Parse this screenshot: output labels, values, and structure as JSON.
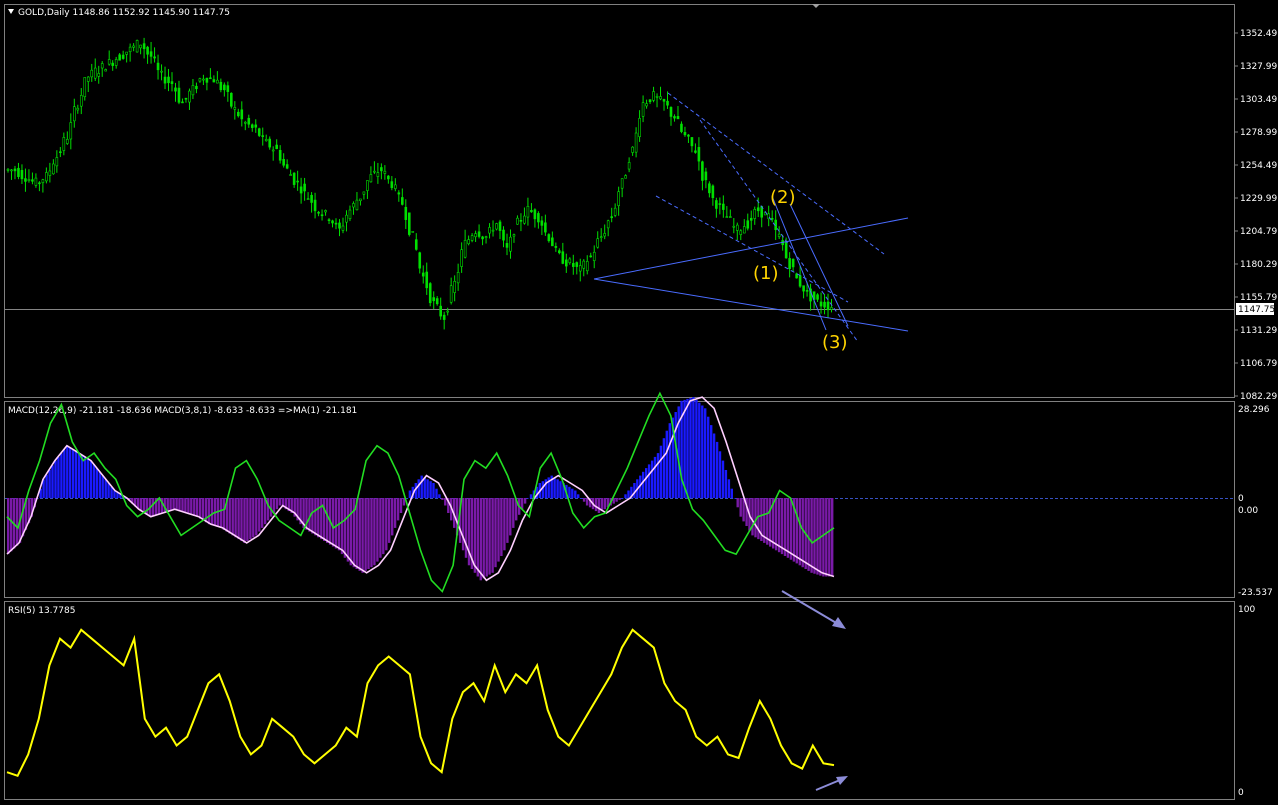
{
  "price_panel": {
    "header": "GOLD,Daily  1148.86 1152.92 1145.90 1147.75",
    "y_ticks": [
      "1352.49",
      "1327.99",
      "1303.49",
      "1278.99",
      "1254.49",
      "1229.99",
      "1204.79",
      "1180.29",
      "1155.79",
      "1131.29",
      "1106.79",
      "1082.29"
    ],
    "current_price": "1147.75",
    "wave_labels": [
      "(1)",
      "(2)",
      "(3)"
    ]
  },
  "macd_panel": {
    "header": "MACD(12,26,9) -21.181 -18.636  MACD(3,8,1) -8.633 -8.633  =>MA(1) -21.181",
    "y_ticks": [
      "28.296",
      "0",
      "0.00",
      "-23.537"
    ]
  },
  "rsi_panel": {
    "header": "RSI(5) 13.7785",
    "y_ticks": [
      "100",
      "0"
    ]
  },
  "colors": {
    "background": "#000000",
    "candle": "#00e000",
    "trendline": "#4a6cff",
    "macd_fast": "#22dd22",
    "macd_signal": "#ffd0ff",
    "histogram_blue": "#1a1aff",
    "histogram_purple": "#7a1aa8",
    "rsi_line": "#ffff00",
    "wave_label": "#ffd400",
    "arrow": "#8c8cd8",
    "grid_axis": "#808080"
  },
  "chart_data": [
    {
      "type": "line",
      "title": "GOLD,Daily",
      "ylim": [
        1082.29,
        1365
      ],
      "series": [
        {
          "name": "GOLD",
          "values": [
            1250,
            1245,
            1240,
            1245,
            1260,
            1275,
            1300,
            1320,
            1325,
            1330,
            1335,
            1340,
            1345,
            1335,
            1320,
            1315,
            1300,
            1310,
            1320,
            1318,
            1310,
            1295,
            1285,
            1280,
            1270,
            1265,
            1250,
            1240,
            1230,
            1220,
            1215,
            1205,
            1220,
            1230,
            1245,
            1250,
            1240,
            1225,
            1200,
            1170,
            1150,
            1140,
            1165,
            1195,
            1205,
            1200,
            1210,
            1190,
            1210,
            1220,
            1215,
            1200,
            1185,
            1180,
            1175,
            1185,
            1200,
            1215,
            1240,
            1265,
            1300,
            1305,
            1300,
            1290,
            1275,
            1265,
            1240,
            1225,
            1215,
            1205,
            1210,
            1220,
            1215,
            1200,
            1180,
            1165,
            1155,
            1150,
            1148
          ]
        }
      ]
    },
    {
      "type": "bar",
      "title": "MACD(12,26,9) -21.181 -18.636  MACD(3,8,1) -8.633 -8.633  =>MA(1) -21.181",
      "ylim": [
        -23.537,
        28.296
      ]
    },
    {
      "type": "line",
      "title": "RSI(5) 13.7785",
      "ylim": [
        0,
        100
      ],
      "series": [
        {
          "name": "RSI(5)",
          "values": [
            10,
            8,
            20,
            40,
            70,
            85,
            80,
            90,
            85,
            80,
            75,
            70,
            85,
            40,
            30,
            35,
            25,
            30,
            45,
            60,
            65,
            50,
            30,
            20,
            25,
            40,
            35,
            30,
            20,
            15,
            20,
            25,
            35,
            30,
            60,
            70,
            75,
            70,
            65,
            30,
            15,
            10,
            40,
            55,
            60,
            50,
            70,
            55,
            65,
            60,
            70,
            45,
            30,
            25,
            35,
            45,
            55,
            65,
            80,
            90,
            85,
            80,
            60,
            50,
            45,
            30,
            25,
            30,
            20,
            18,
            35,
            50,
            40,
            25,
            15,
            12,
            25,
            15,
            14
          ]
        }
      ]
    }
  ]
}
